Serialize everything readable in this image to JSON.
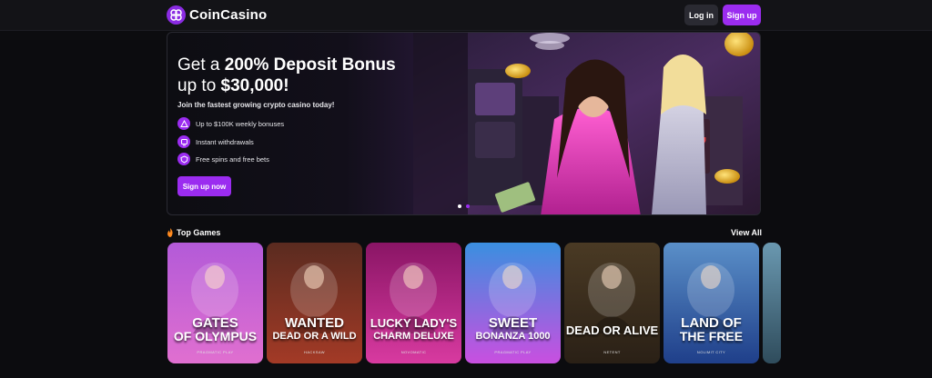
{
  "brand": {
    "name": "CoinCasino"
  },
  "header": {
    "login_label": "Log in",
    "signup_label": "Sign up"
  },
  "hero": {
    "title_prefix": "Get a ",
    "title_bold": "200% Deposit Bonus",
    "title_line2_prefix": "up to ",
    "title_line2_bold": "$30,000!",
    "subtitle": "Join the fastest growing crypto casino today!",
    "features": [
      {
        "icon": "bonus-icon",
        "text": "Up to $100K weekly bonuses"
      },
      {
        "icon": "withdraw-icon",
        "text": "Instant withdrawals"
      },
      {
        "icon": "shield-icon",
        "text": "Free spins and free bets"
      }
    ],
    "cta_label": "Sign up now",
    "carousel": {
      "slides": 2,
      "active": 1
    }
  },
  "top_games": {
    "heading": "Top Games",
    "view_all_label": "View All",
    "games": [
      {
        "name_line1": "GATES",
        "name_line2": "OF OLYMPUS",
        "provider": "PRAGMATIC PLAY",
        "colors": [
          "#b35ad8",
          "#e06fd0"
        ]
      },
      {
        "name_line1": "WANTED",
        "name_line2": "DEAD OR A WILD",
        "provider": "HACKSAW",
        "colors": [
          "#5a2b20",
          "#a33a26"
        ]
      },
      {
        "name_line1": "LUCKY LADY'S",
        "name_line2": "CHARM DELUXE",
        "provider": "NOVOMATIC",
        "colors": [
          "#8a1565",
          "#d83aa0"
        ]
      },
      {
        "name_line1": "SWEET",
        "name_line2": "BONANZA 1000",
        "provider": "PRAGMATIC PLAY",
        "colors": [
          "#3a8fe0",
          "#c94fe0"
        ]
      },
      {
        "name_line1": "DEAD OR ALIVE",
        "name_line2": "",
        "provider": "NETENT",
        "colors": [
          "#4a3a24",
          "#2a2016"
        ]
      },
      {
        "name_line1": "LAND OF",
        "name_line2": "THE FREE",
        "provider": "NOLIMIT CITY",
        "colors": [
          "#5a8fc8",
          "#1f3f8a"
        ]
      }
    ]
  }
}
